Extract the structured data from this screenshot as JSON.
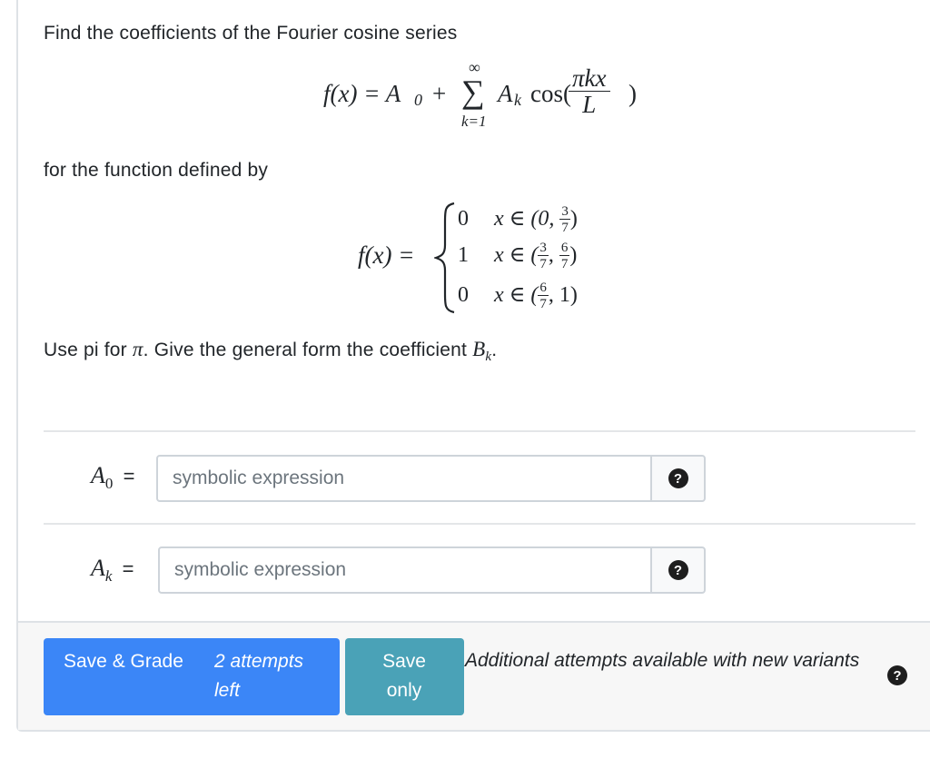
{
  "question": {
    "intro": "Find the coefficients of the Fourier cosine series",
    "series_lhs": "f(x) = A",
    "series_A0_sub": "0",
    "series_plus": "+",
    "sum_upper": "∞",
    "sum_symbol": "∑",
    "sum_lower": "k=1",
    "series_Ak": "A",
    "series_Ak_sub": "k",
    "series_cos": "cos(",
    "series_frac_num": "πkx",
    "series_frac_den": "L",
    "series_close": ")",
    "function_text": "for the function defined by",
    "piecewise_lhs": "f(x) =",
    "cases": [
      {
        "value": "0",
        "domain_prefix": "x ∈ (0,",
        "frac1_num": "3",
        "frac1_den": "7",
        "domain_suffix": ")"
      },
      {
        "value": "1",
        "domain_prefix": "x ∈ (",
        "frac1_num": "3",
        "frac1_den": "7",
        "sep": ",",
        "frac2_num": "6",
        "frac2_den": "7",
        "domain_suffix": ")"
      },
      {
        "value": "0",
        "domain_prefix": "x ∈ (",
        "frac1_num": "6",
        "frac1_den": "7",
        "domain_suffix": ", 1)"
      }
    ],
    "instruction_pre": "Use pi for",
    "instruction_pi": "π",
    "instruction_mid": ". Give the general form the coefficient",
    "instruction_B": "B",
    "instruction_B_sub": "k",
    "instruction_end": "."
  },
  "answers": {
    "a0_label": "A",
    "a0_sub": "0",
    "eq": "=",
    "a0_placeholder": "symbolic expression",
    "ak_label": "A",
    "ak_sub": "k",
    "ak_placeholder": "symbolic expression",
    "help_glyph": "?"
  },
  "footer": {
    "grade_label": "Save & Grade",
    "attempts": "2 attempts left",
    "save_label": "Save only",
    "note": "Additional attempts available with new variants",
    "help_glyph": "?"
  },
  "colors": {
    "primary": "#3b86f7",
    "info": "#4aa2b7",
    "footer_bg": "#f7f7f7"
  }
}
